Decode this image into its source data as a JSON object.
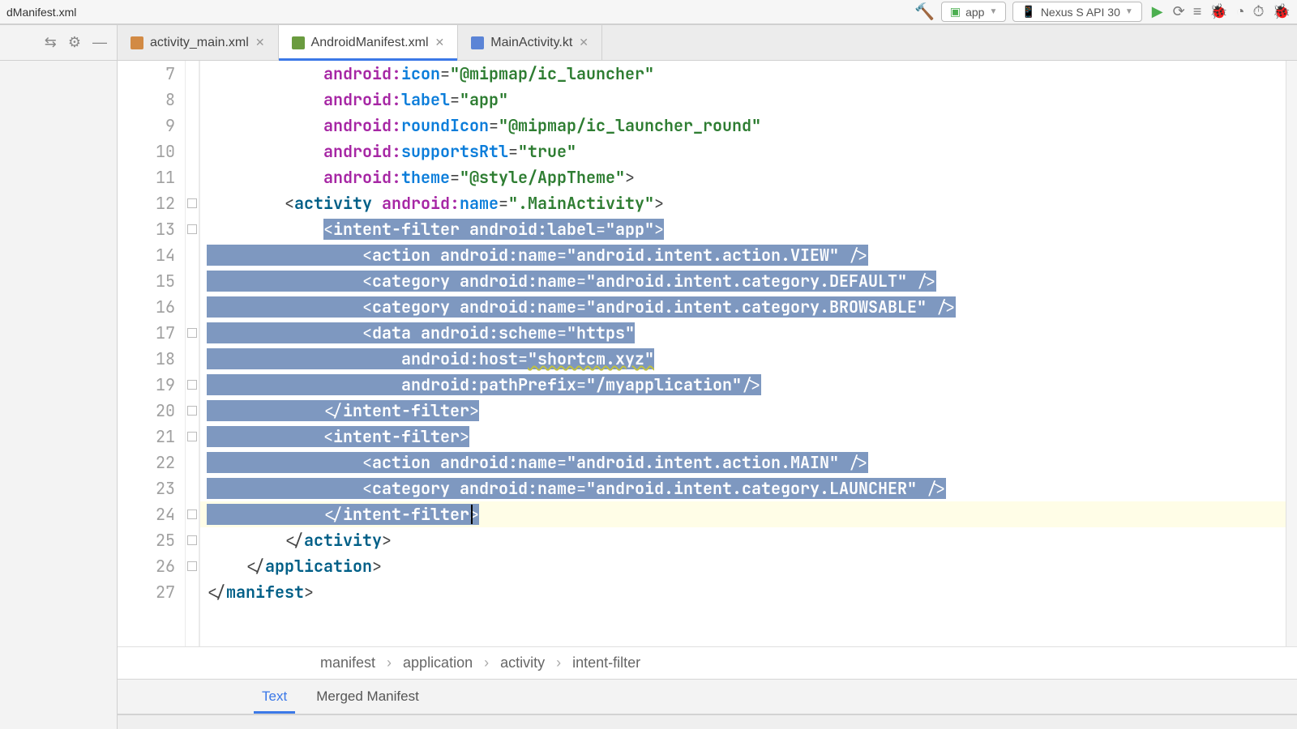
{
  "topbar": {
    "filename_fragment": "dManifest.xml",
    "module": "app",
    "device": "Nexus S API 30"
  },
  "tabs": [
    {
      "label": "activity_main.xml",
      "icon": "xml",
      "active": false
    },
    {
      "label": "AndroidManifest.xml",
      "icon": "mf",
      "active": true
    },
    {
      "label": "MainActivity.kt",
      "icon": "kt",
      "active": false
    }
  ],
  "gutter_start": 7,
  "gutter_end": 27,
  "code": {
    "l7": {
      "ns": "android:",
      "attr": "icon",
      "eq": "=",
      "val": "\"@mipmap/ic_launcher\""
    },
    "l8": {
      "ns": "android:",
      "attr": "label",
      "eq": "=",
      "val": "\"app\""
    },
    "l9": {
      "ns": "android:",
      "attr": "roundIcon",
      "eq": "=",
      "val": "\"@mipmap/ic_launcher_round\""
    },
    "l10": {
      "ns": "android:",
      "attr": "supportsRtl",
      "eq": "=",
      "val": "\"true\""
    },
    "l11": {
      "ns": "android:",
      "attr": "theme",
      "eq": "=",
      "val": "\"@style/AppTheme\"",
      "tail": ">"
    },
    "l12": {
      "open": "<",
      "tag": "activity",
      "sp": " ",
      "ns": "android:",
      "attr": "name",
      "eq": "=",
      "val": "\".MainActivity\"",
      "tail": ">"
    },
    "l13": {
      "open": "<",
      "tag": "intent-filter",
      "sp": " ",
      "ns": "android:",
      "attr": "label",
      "eq": "=",
      "val": "\"app\"",
      "tail": ">"
    },
    "l14": {
      "open": "<",
      "tag": "action",
      "sp": " ",
      "ns": "android:",
      "attr": "name",
      "eq": "=",
      "val": "\"android.intent.action.VIEW\"",
      "tail": " />"
    },
    "l15": {
      "open": "<",
      "tag": "category",
      "sp": " ",
      "ns": "android:",
      "attr": "name",
      "eq": "=",
      "val": "\"android.intent.category.DEFAULT\"",
      "tail": " />"
    },
    "l16": {
      "open": "<",
      "tag": "category",
      "sp": " ",
      "ns": "android:",
      "attr": "name",
      "eq": "=",
      "val": "\"android.intent.category.BROWSABLE\"",
      "tail": " />"
    },
    "l17": {
      "open": "<",
      "tag": "data",
      "sp": " ",
      "ns": "android:",
      "attr": "scheme",
      "eq": "=",
      "val": "\"https\""
    },
    "l18": {
      "ns": "android:",
      "attr": "host",
      "eq": "=",
      "val": "\"shortcm.xyz\""
    },
    "l19": {
      "ns": "android:",
      "attr": "pathPrefix",
      "eq": "=",
      "val": "\"/myapplication\"",
      "tail": "/>"
    },
    "l20": {
      "close": "</",
      "tag": "intent-filter",
      "tail": ">"
    },
    "l21": {
      "open": "<",
      "tag": "intent-filter",
      "tail": ">"
    },
    "l22": {
      "open": "<",
      "tag": "action",
      "sp": " ",
      "ns": "android:",
      "attr": "name",
      "eq": "=",
      "val": "\"android.intent.action.MAIN\"",
      "tail": " />"
    },
    "l23": {
      "open": "<",
      "tag": "category",
      "sp": " ",
      "ns": "android:",
      "attr": "name",
      "eq": "=",
      "val": "\"android.intent.category.LAUNCHER\"",
      "tail": " />"
    },
    "l24": {
      "close": "</",
      "tag": "intent-filter",
      "tail": ">"
    },
    "l25": {
      "close": "</",
      "tag": "activity",
      "tail": ">"
    },
    "l26": {
      "close": "</",
      "tag": "application",
      "tail": ">"
    },
    "l27": {
      "close": "</",
      "tag": "manifest",
      "tail": ">"
    }
  },
  "breadcrumbs": [
    "manifest",
    "application",
    "activity",
    "intent-filter"
  ],
  "bottom_tabs": [
    {
      "label": "Text",
      "active": true
    },
    {
      "label": "Merged Manifest",
      "active": false
    }
  ]
}
